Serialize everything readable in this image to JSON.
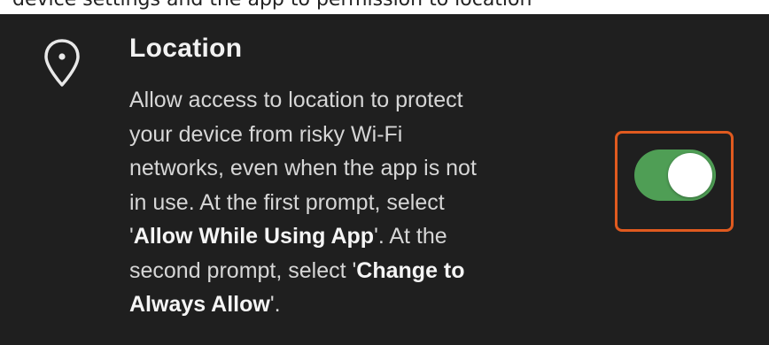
{
  "caption": {
    "text": "device settings and the app to permission to location"
  },
  "location_setting": {
    "icon": "location-pin-icon",
    "title": "Location",
    "description_lines": [
      {
        "pre": "Allow access to location to protect",
        "bold": "",
        "post": ""
      },
      {
        "pre": "your device from risky Wi-Fi",
        "bold": "",
        "post": ""
      },
      {
        "pre": "networks, even when the app is not",
        "bold": "",
        "post": ""
      },
      {
        "pre": "in use. At the first prompt, select",
        "bold": "",
        "post": ""
      },
      {
        "pre": "'",
        "bold": "Allow While Using App",
        "post": "'. At the"
      },
      {
        "pre": "second prompt, select '",
        "bold": "Change to",
        "post": ""
      },
      {
        "pre": "",
        "bold": "Always Allow",
        "post": "'."
      }
    ],
    "toggle": {
      "state": "on",
      "on_color": "#4f9e55"
    },
    "highlight_color": "#e05a1f"
  }
}
